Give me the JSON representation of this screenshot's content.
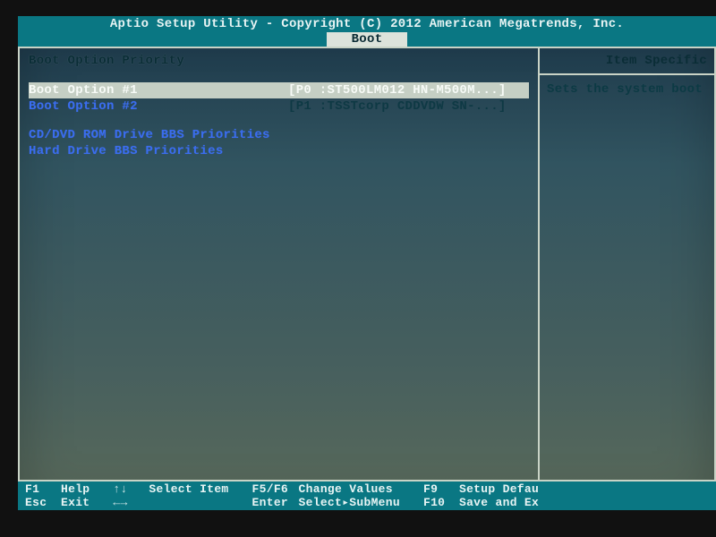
{
  "header": {
    "title": "Aptio Setup Utility - Copyright (C) 2012 American Megatrends, Inc.",
    "active_tab": "Boot"
  },
  "main": {
    "section_title": "Boot Option Priority",
    "options": [
      {
        "label": "Boot Option #1",
        "value": "[P0 :ST500LM012 HN-M500M...]",
        "selected": true
      },
      {
        "label": "Boot Option #2",
        "value": "[P1 :TSSTcorp CDDVDW SN-...]",
        "selected": false
      }
    ],
    "submenus": [
      "CD/DVD ROM Drive BBS Priorities",
      "Hard Drive BBS Priorities"
    ]
  },
  "side": {
    "title": "Item Specific",
    "help": "Sets the system boot"
  },
  "footer": {
    "group1": {
      "k1": "F1",
      "l1": "Help",
      "k2": "Esc",
      "l2": "Exit"
    },
    "group2": {
      "k1": "↑↓",
      "l1": "Select Item",
      "k2": "←→",
      "l2": ""
    },
    "group3": {
      "k1": "F5/F6",
      "l1": "Change Values",
      "k2": "Enter",
      "l2": "Select▸SubMenu"
    },
    "group4": {
      "k1": "F9",
      "l1": "Setup Defau",
      "k2": "F10",
      "l2": "Save and Ex"
    }
  }
}
